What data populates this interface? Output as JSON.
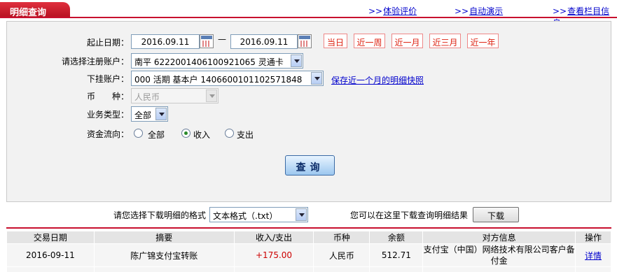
{
  "header": {
    "title": "明细查询",
    "links": [
      {
        "arrow": ">>",
        "label": "体验评价"
      },
      {
        "arrow": ">>",
        "label": "自动演示"
      },
      {
        "arrow": ">>",
        "label": "查看栏目信息"
      }
    ]
  },
  "form": {
    "date_label": "起止日期：",
    "start_date": "2016.09.11",
    "end_date": "2016.09.11",
    "date_separator": "—",
    "quick_ranges": [
      "当日",
      "近一周",
      "近一月",
      "近三月",
      "近一年"
    ],
    "account_label": "请选择注册账户：",
    "account_value": "南平 6222001406100921065 灵通卡",
    "subaccount_label": "下挂账户：",
    "subaccount_value": "000 活期 基本户 1406600101102571848",
    "save_snapshot_link": "保存近一个月的明细快照",
    "currency_label": "币　　种：",
    "currency_value": "人民币",
    "biz_type_label": "业务类型：",
    "biz_type_value": "全部",
    "flow_label": "资金流向：",
    "flow_options": [
      "全部",
      "收入",
      "支出"
    ],
    "flow_selected": "收入",
    "search_button": "查询"
  },
  "download": {
    "format_label": "请您选择下载明细的格式",
    "format_value": "文本格式（.txt）",
    "hint": "您可以在这里下载查询明细结果",
    "button": "下载"
  },
  "table": {
    "columns": [
      "交易日期",
      "摘要",
      "收入/支出",
      "币种",
      "余额",
      "对方信息",
      "操作"
    ],
    "rows": [
      {
        "date": "2016-09-11",
        "summary": "陈广锦支付宝转账",
        "amount": "+175.00",
        "currency": "人民币",
        "balance": "512.71",
        "party": "支付宝（中国）网络技术有限公司客户备付金",
        "action": "详情"
      }
    ]
  },
  "colors": {
    "brand_red": "#c8102e",
    "link_blue": "#0000cc",
    "income_red": "#cc0000"
  }
}
